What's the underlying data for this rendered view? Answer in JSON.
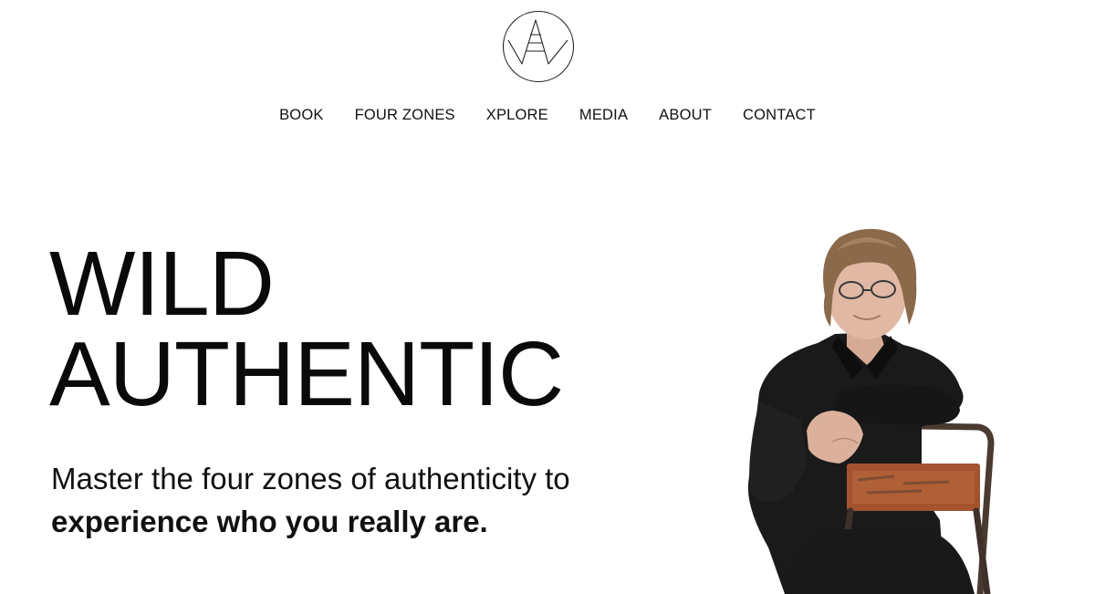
{
  "nav": {
    "items": [
      {
        "label": "BOOK"
      },
      {
        "label": "FOUR ZONES"
      },
      {
        "label": "XPLORE"
      },
      {
        "label": "MEDIA"
      },
      {
        "label": "ABOUT"
      },
      {
        "label": "CONTACT"
      }
    ]
  },
  "hero": {
    "title_line1": "WILD",
    "title_line2": "AUTHENTIC",
    "tagline_regular": "Master the four zones of authenticity to ",
    "tagline_bold": "experience who you really are."
  },
  "colors": {
    "text": "#111111",
    "background": "#ffffff",
    "shirt": "#1a1a1a",
    "chair_metal": "#4a3a30",
    "chair_rust": "#a5532e"
  },
  "icons": {
    "logo": "wa-monogram-circle-logo"
  }
}
